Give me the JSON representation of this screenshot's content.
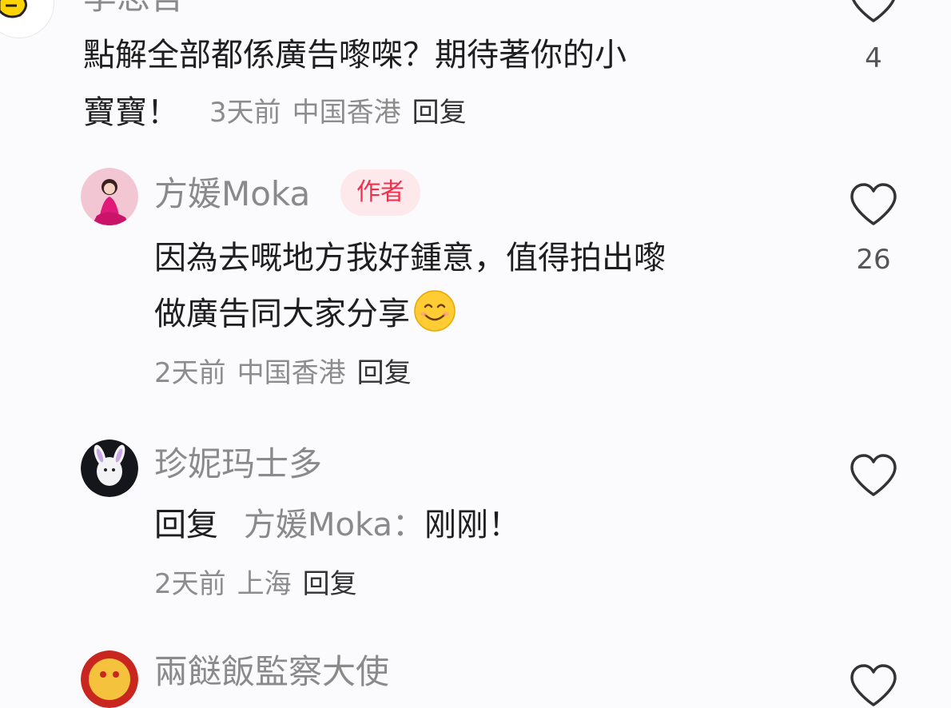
{
  "comments": [
    {
      "username": "李思吾",
      "text_line1": "點解全部都係廣告嚟㗎？期待著你的小",
      "text_line2": "寶寶！",
      "time": "3天前",
      "location": "中国香港",
      "reply_label": "回复",
      "likes": "4"
    },
    {
      "username": "方媛Moka",
      "badge": "作者",
      "text_line1": "因為去嘅地方我好鍾意，值得拍出嚟",
      "text_line2": "做廣告同大家分享",
      "time": "2天前",
      "location": "中国香港",
      "reply_label": "回复",
      "likes": "26"
    },
    {
      "username": "珍妮玛士多",
      "reply_prefix": "回复",
      "mention": "方媛Moka：",
      "text": "刚刚！",
      "time": "2天前",
      "location": "上海",
      "reply_label": "回复",
      "likes": ""
    },
    {
      "username": "兩餸飯監察大使"
    }
  ],
  "colors": {
    "background": "#fbfbfd",
    "badge_text": "#ef2f4c",
    "badge_bg": "#fde8eb",
    "meta_gray": "#8c8c8c"
  }
}
